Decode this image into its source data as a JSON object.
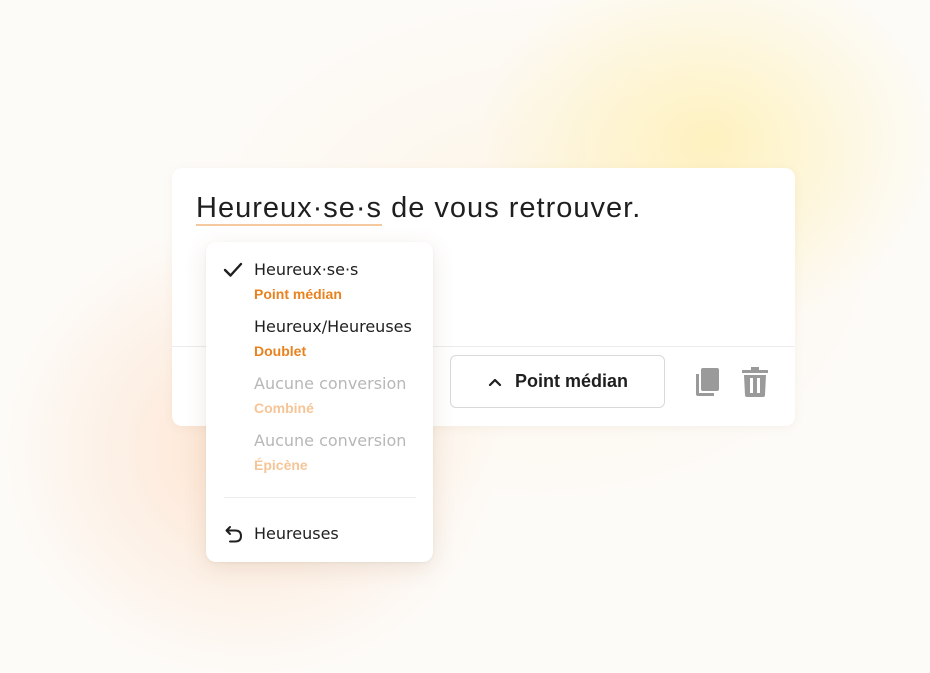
{
  "editor": {
    "sentence_flagged": "Heureux·se·s",
    "sentence_rest": " de vous retrouver."
  },
  "toolbar": {
    "mode_label": "Point médian",
    "copy_icon": "copy-icon",
    "delete_icon": "trash-icon"
  },
  "dropdown": {
    "options": [
      {
        "main": "Heureux·se·s",
        "sub": "Point médian",
        "selected": true,
        "disabled": false
      },
      {
        "main": "Heureux/Heureuses",
        "sub": "Doublet",
        "selected": false,
        "disabled": false
      },
      {
        "main": "Aucune conversion",
        "sub": "Combiné",
        "selected": false,
        "disabled": true
      },
      {
        "main": "Aucune conversion",
        "sub": "Épicène",
        "selected": false,
        "disabled": true
      }
    ],
    "revert_label": "Heureuses"
  },
  "colors": {
    "accent": "#e8821e",
    "accent_disabled": "#f6c597",
    "underline": "#f5c9a0",
    "icon_gray": "#9a9a9a"
  }
}
